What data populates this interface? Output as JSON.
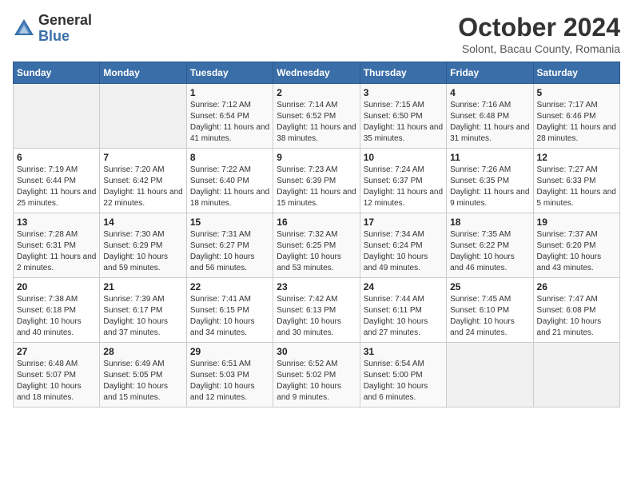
{
  "logo": {
    "general": "General",
    "blue": "Blue"
  },
  "header": {
    "month": "October 2024",
    "location": "Solont, Bacau County, Romania"
  },
  "weekdays": [
    "Sunday",
    "Monday",
    "Tuesday",
    "Wednesday",
    "Thursday",
    "Friday",
    "Saturday"
  ],
  "weeks": [
    [
      {
        "day": "",
        "empty": true
      },
      {
        "day": "",
        "empty": true
      },
      {
        "day": "1",
        "sunrise": "Sunrise: 7:12 AM",
        "sunset": "Sunset: 6:54 PM",
        "daylight": "Daylight: 11 hours and 41 minutes."
      },
      {
        "day": "2",
        "sunrise": "Sunrise: 7:14 AM",
        "sunset": "Sunset: 6:52 PM",
        "daylight": "Daylight: 11 hours and 38 minutes."
      },
      {
        "day": "3",
        "sunrise": "Sunrise: 7:15 AM",
        "sunset": "Sunset: 6:50 PM",
        "daylight": "Daylight: 11 hours and 35 minutes."
      },
      {
        "day": "4",
        "sunrise": "Sunrise: 7:16 AM",
        "sunset": "Sunset: 6:48 PM",
        "daylight": "Daylight: 11 hours and 31 minutes."
      },
      {
        "day": "5",
        "sunrise": "Sunrise: 7:17 AM",
        "sunset": "Sunset: 6:46 PM",
        "daylight": "Daylight: 11 hours and 28 minutes."
      }
    ],
    [
      {
        "day": "6",
        "sunrise": "Sunrise: 7:19 AM",
        "sunset": "Sunset: 6:44 PM",
        "daylight": "Daylight: 11 hours and 25 minutes."
      },
      {
        "day": "7",
        "sunrise": "Sunrise: 7:20 AM",
        "sunset": "Sunset: 6:42 PM",
        "daylight": "Daylight: 11 hours and 22 minutes."
      },
      {
        "day": "8",
        "sunrise": "Sunrise: 7:22 AM",
        "sunset": "Sunset: 6:40 PM",
        "daylight": "Daylight: 11 hours and 18 minutes."
      },
      {
        "day": "9",
        "sunrise": "Sunrise: 7:23 AM",
        "sunset": "Sunset: 6:39 PM",
        "daylight": "Daylight: 11 hours and 15 minutes."
      },
      {
        "day": "10",
        "sunrise": "Sunrise: 7:24 AM",
        "sunset": "Sunset: 6:37 PM",
        "daylight": "Daylight: 11 hours and 12 minutes."
      },
      {
        "day": "11",
        "sunrise": "Sunrise: 7:26 AM",
        "sunset": "Sunset: 6:35 PM",
        "daylight": "Daylight: 11 hours and 9 minutes."
      },
      {
        "day": "12",
        "sunrise": "Sunrise: 7:27 AM",
        "sunset": "Sunset: 6:33 PM",
        "daylight": "Daylight: 11 hours and 5 minutes."
      }
    ],
    [
      {
        "day": "13",
        "sunrise": "Sunrise: 7:28 AM",
        "sunset": "Sunset: 6:31 PM",
        "daylight": "Daylight: 11 hours and 2 minutes."
      },
      {
        "day": "14",
        "sunrise": "Sunrise: 7:30 AM",
        "sunset": "Sunset: 6:29 PM",
        "daylight": "Daylight: 10 hours and 59 minutes."
      },
      {
        "day": "15",
        "sunrise": "Sunrise: 7:31 AM",
        "sunset": "Sunset: 6:27 PM",
        "daylight": "Daylight: 10 hours and 56 minutes."
      },
      {
        "day": "16",
        "sunrise": "Sunrise: 7:32 AM",
        "sunset": "Sunset: 6:25 PM",
        "daylight": "Daylight: 10 hours and 53 minutes."
      },
      {
        "day": "17",
        "sunrise": "Sunrise: 7:34 AM",
        "sunset": "Sunset: 6:24 PM",
        "daylight": "Daylight: 10 hours and 49 minutes."
      },
      {
        "day": "18",
        "sunrise": "Sunrise: 7:35 AM",
        "sunset": "Sunset: 6:22 PM",
        "daylight": "Daylight: 10 hours and 46 minutes."
      },
      {
        "day": "19",
        "sunrise": "Sunrise: 7:37 AM",
        "sunset": "Sunset: 6:20 PM",
        "daylight": "Daylight: 10 hours and 43 minutes."
      }
    ],
    [
      {
        "day": "20",
        "sunrise": "Sunrise: 7:38 AM",
        "sunset": "Sunset: 6:18 PM",
        "daylight": "Daylight: 10 hours and 40 minutes."
      },
      {
        "day": "21",
        "sunrise": "Sunrise: 7:39 AM",
        "sunset": "Sunset: 6:17 PM",
        "daylight": "Daylight: 10 hours and 37 minutes."
      },
      {
        "day": "22",
        "sunrise": "Sunrise: 7:41 AM",
        "sunset": "Sunset: 6:15 PM",
        "daylight": "Daylight: 10 hours and 34 minutes."
      },
      {
        "day": "23",
        "sunrise": "Sunrise: 7:42 AM",
        "sunset": "Sunset: 6:13 PM",
        "daylight": "Daylight: 10 hours and 30 minutes."
      },
      {
        "day": "24",
        "sunrise": "Sunrise: 7:44 AM",
        "sunset": "Sunset: 6:11 PM",
        "daylight": "Daylight: 10 hours and 27 minutes."
      },
      {
        "day": "25",
        "sunrise": "Sunrise: 7:45 AM",
        "sunset": "Sunset: 6:10 PM",
        "daylight": "Daylight: 10 hours and 24 minutes."
      },
      {
        "day": "26",
        "sunrise": "Sunrise: 7:47 AM",
        "sunset": "Sunset: 6:08 PM",
        "daylight": "Daylight: 10 hours and 21 minutes."
      }
    ],
    [
      {
        "day": "27",
        "sunrise": "Sunrise: 6:48 AM",
        "sunset": "Sunset: 5:07 PM",
        "daylight": "Daylight: 10 hours and 18 minutes."
      },
      {
        "day": "28",
        "sunrise": "Sunrise: 6:49 AM",
        "sunset": "Sunset: 5:05 PM",
        "daylight": "Daylight: 10 hours and 15 minutes."
      },
      {
        "day": "29",
        "sunrise": "Sunrise: 6:51 AM",
        "sunset": "Sunset: 5:03 PM",
        "daylight": "Daylight: 10 hours and 12 minutes."
      },
      {
        "day": "30",
        "sunrise": "Sunrise: 6:52 AM",
        "sunset": "Sunset: 5:02 PM",
        "daylight": "Daylight: 10 hours and 9 minutes."
      },
      {
        "day": "31",
        "sunrise": "Sunrise: 6:54 AM",
        "sunset": "Sunset: 5:00 PM",
        "daylight": "Daylight: 10 hours and 6 minutes."
      },
      {
        "day": "",
        "empty": true
      },
      {
        "day": "",
        "empty": true
      }
    ]
  ]
}
